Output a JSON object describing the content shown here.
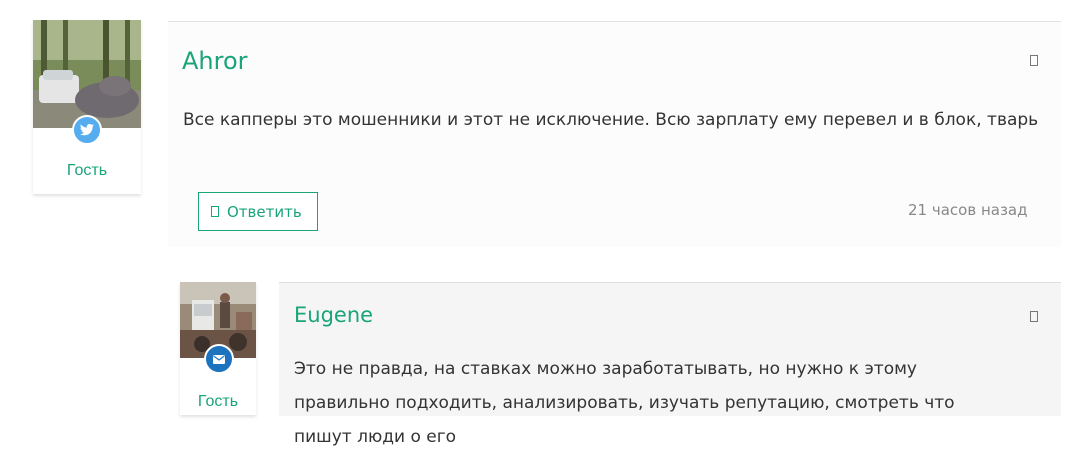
{
  "comments": [
    {
      "author": "Ahror",
      "role": "Гость",
      "badge": "twitter-icon",
      "text": "Все капперы это мошенники и этот не исключение. Всю зарплату ему перевел и в блок, тварь",
      "reply_label": "Ответить",
      "time": "21 часов назад"
    },
    {
      "author": "Eugene",
      "role": "Гость",
      "badge": "email-icon",
      "text": "Это не правда, на ставках можно заработатывать, но нужно к этому правильно подходить, анализировать, изучать репутацию, смотреть что пишут люди о его"
    }
  ],
  "colors": {
    "accent": "#1aa47a",
    "twitter": "#55acee",
    "email": "#1e73be"
  }
}
